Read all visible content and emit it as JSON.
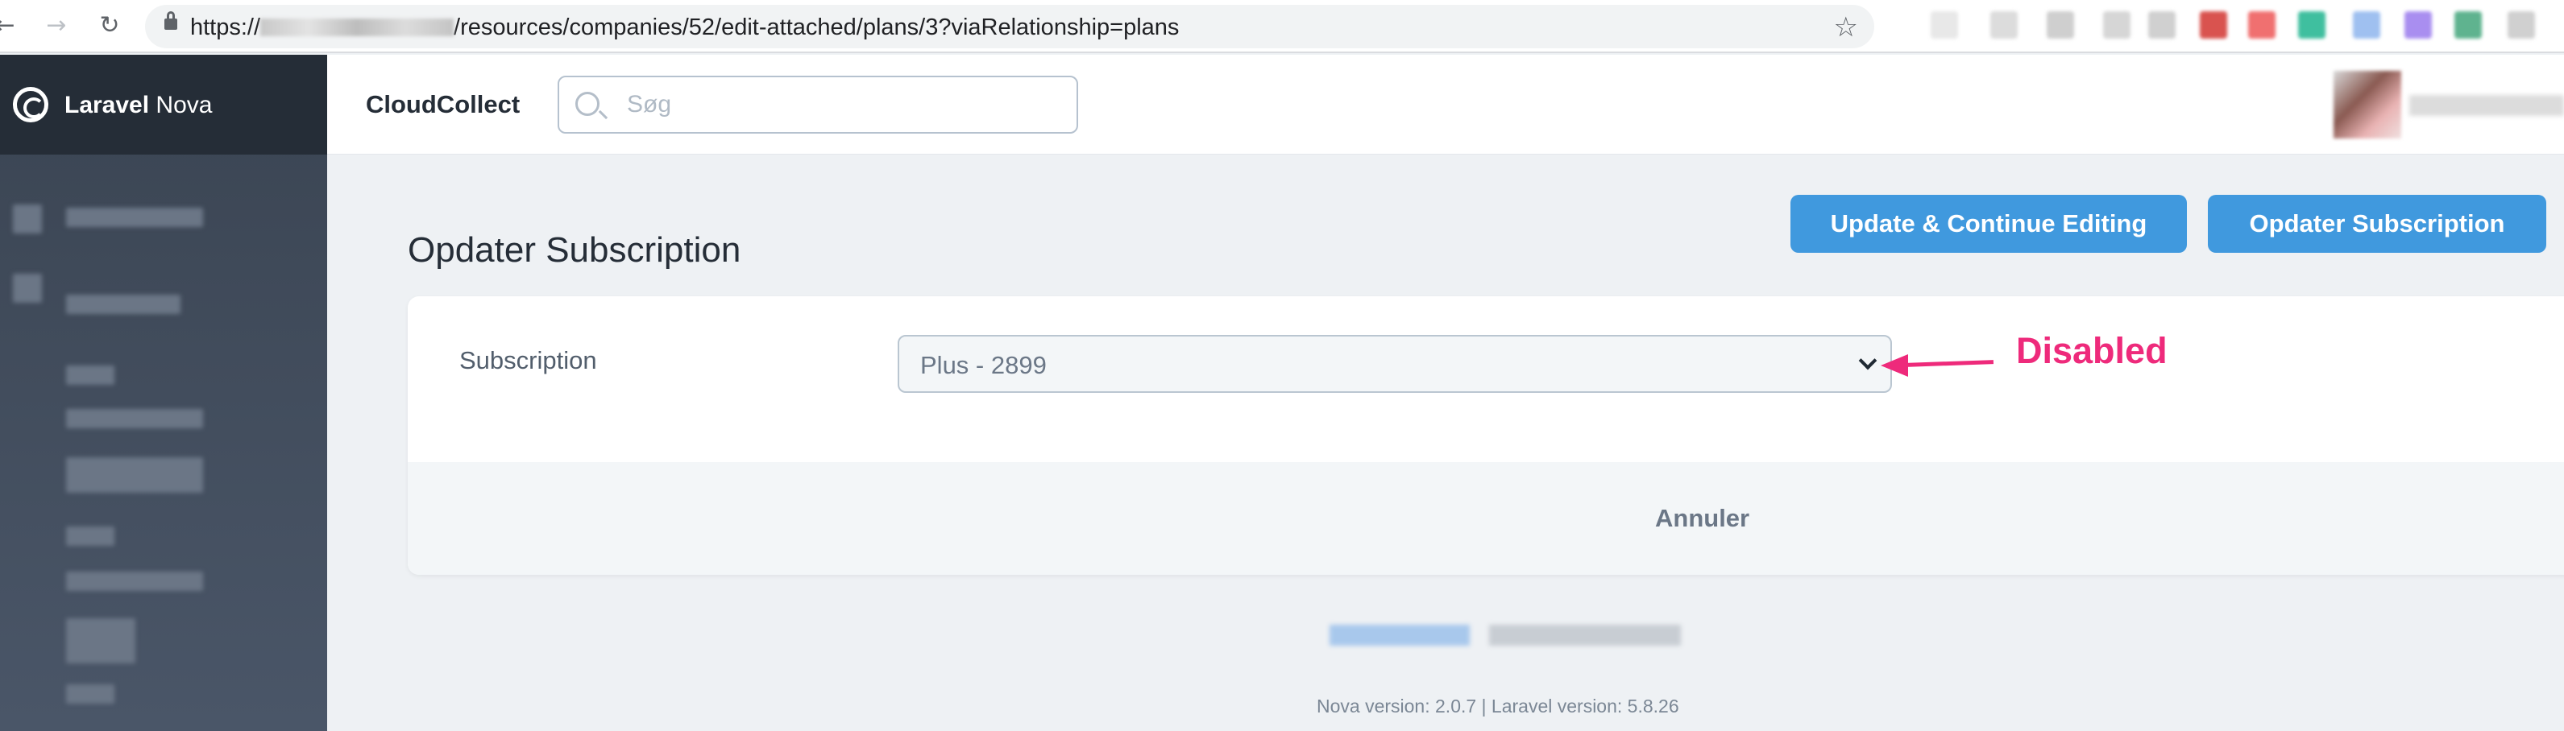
{
  "browser": {
    "url_prefix": "https://",
    "url_path": "/resources/companies/52/edit-attached/plans/3?viaRelationship=plans",
    "back_icon": "arrow-left-icon",
    "forward_icon": "arrow-right-icon",
    "reload_icon": "reload-icon",
    "bookmark_icon": "star-icon"
  },
  "sidebar": {
    "brand_bold": "Laravel",
    "brand_rest": " Nova"
  },
  "header": {
    "app_name": "CloudCollect",
    "search_placeholder": "Søg"
  },
  "page": {
    "title": "Opdater Subscription"
  },
  "form": {
    "field_label": "Subscription",
    "select_value": "Plus - 2899",
    "select_disabled": true
  },
  "actions": {
    "cancel": "Annuler",
    "update_continue": "Update & Continue Editing",
    "update": "Opdater Subscription"
  },
  "annotation": {
    "text": "Disabled",
    "color": "#ee2a7b"
  },
  "footer": {
    "version": "Nova version: 2.0.7 | Laravel version: 5.8.26"
  },
  "colors": {
    "primary": "#4099de",
    "sidebar": "#3a4452",
    "brand_bg": "#252d37"
  }
}
